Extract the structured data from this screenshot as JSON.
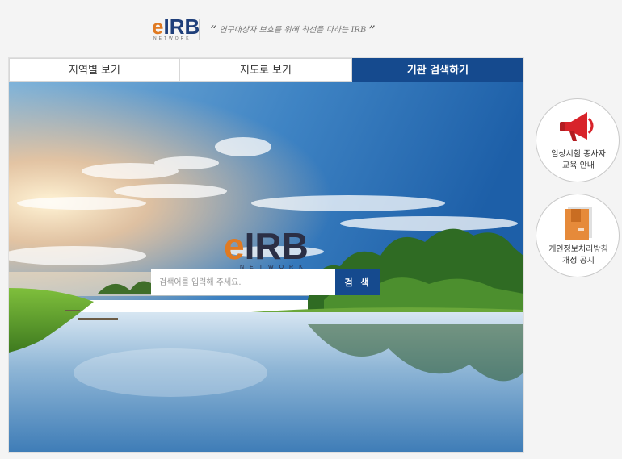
{
  "header": {
    "logo_e": "e",
    "logo_irb": "IRB",
    "logo_network": "NETWORK",
    "slogan_open": "“",
    "slogan": "연구대상자 보호를 위해 최선을 다하는 IRB",
    "slogan_close": "”"
  },
  "tabs": [
    {
      "label": "지역별 보기",
      "active": false
    },
    {
      "label": "지도로 보기",
      "active": false
    },
    {
      "label": "기관 검색하기",
      "active": true
    }
  ],
  "hero": {
    "logo_e": "e",
    "logo_irb": "IRB",
    "logo_network": "NETWORK"
  },
  "search": {
    "placeholder": "검색어를 입력해 주세요.",
    "button_label": "검 색"
  },
  "side_buttons": [
    {
      "line1": "임상시험 종사자",
      "line2": "교육 안내",
      "icon": "megaphone-icon"
    },
    {
      "line1": "개인정보처리방침",
      "line2": "개정 공지",
      "icon": "document-icon"
    }
  ],
  "colors": {
    "accent_blue": "#154a8e",
    "brand_orange": "#e07a22",
    "megaphone_red": "#d8232a"
  }
}
